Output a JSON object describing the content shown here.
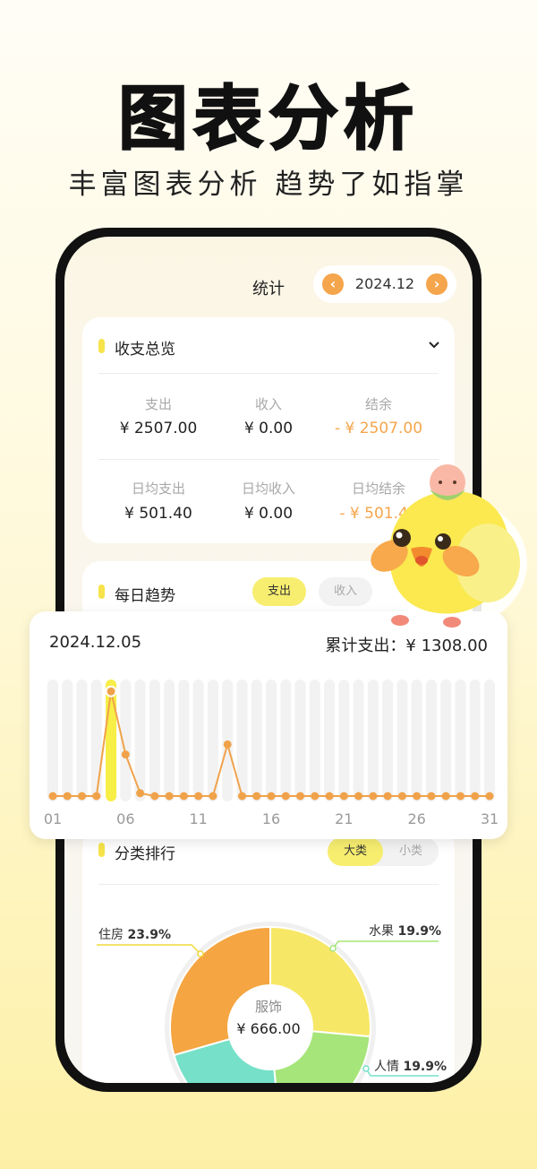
{
  "hero": {
    "title": "图表分析",
    "subtitle": "丰富图表分析 趋势了如指掌"
  },
  "header": {
    "title": "统计",
    "month": "2024.12",
    "prev_icon": "chevron-left-icon",
    "next_icon": "chevron-right-icon"
  },
  "overview": {
    "title": "收支总览",
    "rows": [
      [
        {
          "label": "支出",
          "value": "¥ 2507.00"
        },
        {
          "label": "收入",
          "value": "¥ 0.00"
        },
        {
          "label": "结余",
          "value": "- ¥ 2507.00"
        }
      ],
      [
        {
          "label": "日均支出",
          "value": "¥ 501.40"
        },
        {
          "label": "日均收入",
          "value": "¥ 0.00"
        },
        {
          "label": "日均结余",
          "value": "- ¥ 501.40"
        }
      ]
    ]
  },
  "daily": {
    "title": "每日趋势",
    "tab_expense": "支出",
    "tab_income": "收入"
  },
  "trend": {
    "date": "2024.12.05",
    "total": "累计支出：¥ 1308.00",
    "x_labels": [
      "01",
      "06",
      "11",
      "16",
      "21",
      "26",
      "31"
    ]
  },
  "ranking": {
    "title": "分类排行",
    "tab_big": "大类",
    "tab_small": "小类"
  },
  "pie_center": {
    "name": "服饰",
    "value": "¥ 666.00"
  },
  "pie_labels": {
    "housing": {
      "name": "住房",
      "pct": "23.9%"
    },
    "fruit": {
      "name": "水果",
      "pct": "19.9%"
    },
    "gift": {
      "name": "人情",
      "pct": "19.9%"
    }
  },
  "chart_data": {
    "type": "line",
    "title": "",
    "x": [
      1,
      2,
      3,
      4,
      5,
      6,
      7,
      8,
      9,
      10,
      11,
      12,
      13,
      14,
      15,
      16,
      17,
      18,
      19,
      20,
      21,
      22,
      23,
      24,
      25,
      26,
      27,
      28,
      29,
      30,
      31
    ],
    "series": [
      {
        "values": [
          0,
          0,
          0,
          0,
          730,
          290,
          20,
          0,
          0,
          0,
          0,
          0,
          360,
          0,
          0,
          0,
          0,
          0,
          0,
          0,
          0,
          0,
          0,
          0,
          0,
          0,
          0,
          0,
          0,
          0,
          0
        ]
      }
    ],
    "ylim": [
      0,
      800
    ],
    "highlight_x": 5,
    "colors": {
      "line": "#f0a24a",
      "highlight": "#f7ee46",
      "track": "#f2f2f2"
    }
  },
  "pie_data": {
    "type": "pie",
    "slices": [
      {
        "name": "住房",
        "pct": 23.9,
        "color": "#f7e766"
      },
      {
        "name": "水果",
        "pct": 19.9,
        "color": "#a6e57a"
      },
      {
        "name": "人情",
        "pct": 19.9,
        "color": "#76e0c8"
      },
      {
        "name": "服饰",
        "pct": 26.6,
        "color": "#f5a541"
      }
    ]
  }
}
